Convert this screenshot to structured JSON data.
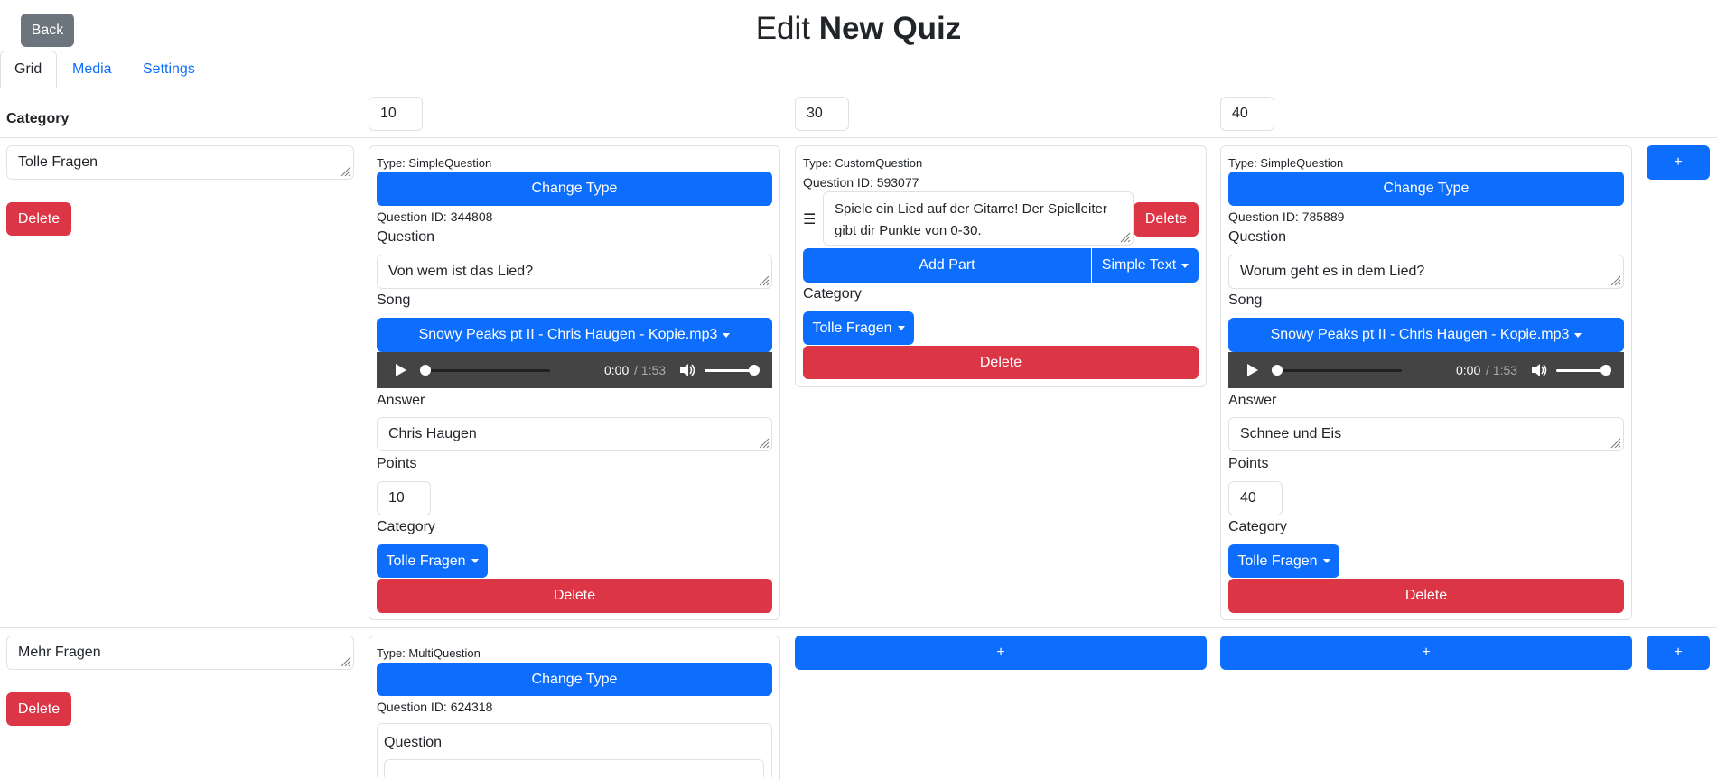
{
  "header": {
    "back_label": "Back",
    "title_prefix": "Edit",
    "title_name": "New Quiz"
  },
  "tabs": [
    {
      "label": "Grid",
      "active": true
    },
    {
      "label": "Media",
      "active": false
    },
    {
      "label": "Settings",
      "active": false
    }
  ],
  "grid": {
    "category_header": "Category",
    "point_columns": [
      "10",
      "30",
      "40"
    ],
    "add_label": "+",
    "rows": [
      {
        "category": "Tolle Fragen",
        "delete_label": "Delete",
        "cells": [
          {
            "type_text": "Type: SimpleQuestion",
            "change_type_label": "Change Type",
            "id_text": "Question ID: 344808",
            "question_label": "Question",
            "question_value": "Von wem ist das Lied?",
            "song_label": "Song",
            "song_value": "Snowy Peaks pt II - Chris Haugen - Kopie.mp3",
            "audio_current": "0:00",
            "audio_total": "/ 1:53",
            "answer_label": "Answer",
            "answer_value": "Chris Haugen",
            "points_label": "Points",
            "points_value": "10",
            "category_label": "Category",
            "category_value": "Tolle Fragen",
            "delete_label": "Delete"
          },
          {
            "type_text": "Type: CustomQuestion",
            "id_text": "Question ID: 593077",
            "part_text": "Spiele ein Lied auf der Gitarre! Der Spielleiter gibt dir Punkte von 0-30.",
            "part_delete_label": "Delete",
            "add_part_label": "Add Part",
            "part_type_label": "Simple Text",
            "category_label": "Category",
            "category_value": "Tolle Fragen",
            "delete_label": "Delete"
          },
          {
            "type_text": "Type: SimpleQuestion",
            "change_type_label": "Change Type",
            "id_text": "Question ID: 785889",
            "question_label": "Question",
            "question_value": "Worum geht es in dem Lied?",
            "song_label": "Song",
            "song_value": "Snowy Peaks pt II - Chris Haugen - Kopie.mp3",
            "audio_current": "0:00",
            "audio_total": "/ 1:53",
            "answer_label": "Answer",
            "answer_value": "Schnee und Eis",
            "points_label": "Points",
            "points_value": "40",
            "category_label": "Category",
            "category_value": "Tolle Fragen",
            "delete_label": "Delete"
          }
        ]
      },
      {
        "category": "Mehr Fragen",
        "delete_label": "Delete",
        "cells": [
          {
            "type_text": "Type: MultiQuestion",
            "change_type_label": "Change Type",
            "id_text": "Question ID: 624318",
            "question_label": "Question"
          }
        ]
      }
    ]
  },
  "colors": {
    "primary": "#0d6efd",
    "danger": "#dc3545",
    "secondary": "#6c757d",
    "link": "#0d6efd",
    "audio_bg": "#444444"
  }
}
